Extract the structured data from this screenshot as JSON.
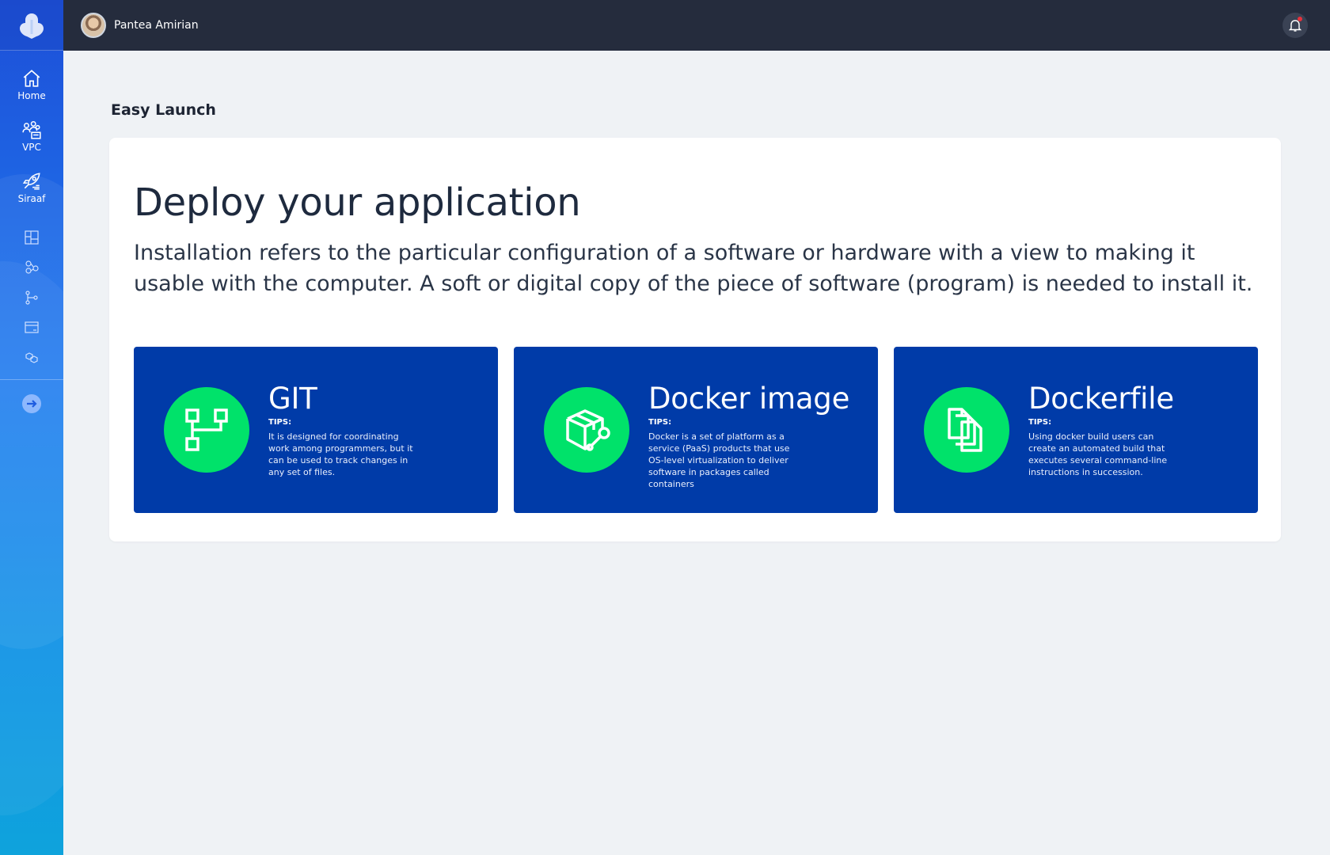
{
  "user": {
    "name": "Pantea Amirian"
  },
  "sidebar": {
    "items": [
      {
        "label": "Home",
        "icon": "home-icon"
      },
      {
        "label": "VPC",
        "icon": "vpc-icon"
      },
      {
        "label": "Siraaf",
        "icon": "rocket-icon"
      }
    ],
    "small_icons": [
      "dashboard-icon",
      "nodes-icon",
      "git-branch-icon",
      "browser-window-icon",
      "cubes-icon"
    ],
    "expand_icon": "arrow-right-icon"
  },
  "page": {
    "section_title": "Easy Launch",
    "headline": "Deploy your application",
    "description": "Installation refers to the particular configuration of a software or hardware with a view to making it usable with the computer. A soft or digital copy of the piece of software (program) is needed to install it."
  },
  "cards": [
    {
      "title": "GIT",
      "tips_label": "TIPS:",
      "text": "It is designed for coordinating work among programmers, but it can be used to track changes in any set of files.",
      "icon": "git-flow-icon"
    },
    {
      "title": "Docker image",
      "tips_label": "TIPS:",
      "text": "Docker is a set of platform as a service (PaaS) products that use OS-level virtualization to deliver software in packages called containers",
      "icon": "package-wrench-icon"
    },
    {
      "title": "Dockerfile",
      "tips_label": "TIPS:",
      "text": "Using docker build users can create an automated build that executes several command-line instructions in succession.",
      "icon": "documents-icon"
    }
  ],
  "colors": {
    "topbar": "#252c3d",
    "card": "#003ba8",
    "card_icon_bg": "#00e26a",
    "notification_dot": "#e8323c"
  }
}
